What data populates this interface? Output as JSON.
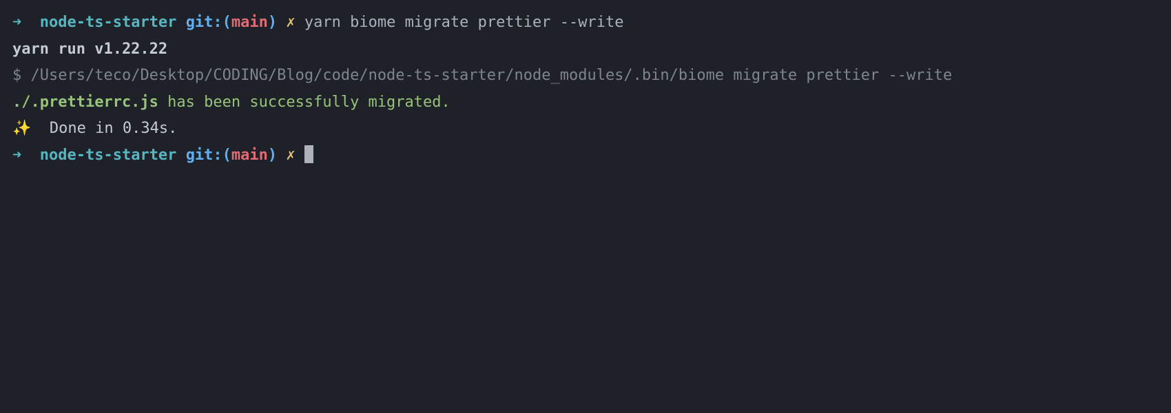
{
  "prompt1": {
    "arrow": "➜",
    "cwd": "node-ts-starter",
    "git_label": "git:",
    "paren_open": "(",
    "branch": "main",
    "paren_close": ")",
    "dirty_marker": "✗",
    "command_yarn": "yarn",
    "command_rest": "biome migrate prettier --write"
  },
  "output": {
    "yarn_run": "yarn run v1.22.22",
    "dollar": "$",
    "exec_path": "/Users/teco/Desktop/CODING/Blog/code/node-ts-starter/node_modules/.bin/biome migrate prettier --write",
    "success_file": "./.prettierrc.js",
    "success_msg": " has been successfully migrated.",
    "sparkle": "✨",
    "done": "Done in 0.34s."
  },
  "prompt2": {
    "arrow": "➜",
    "cwd": "node-ts-starter",
    "git_label": "git:",
    "paren_open": "(",
    "branch": "main",
    "paren_close": ")",
    "dirty_marker": "✗"
  }
}
